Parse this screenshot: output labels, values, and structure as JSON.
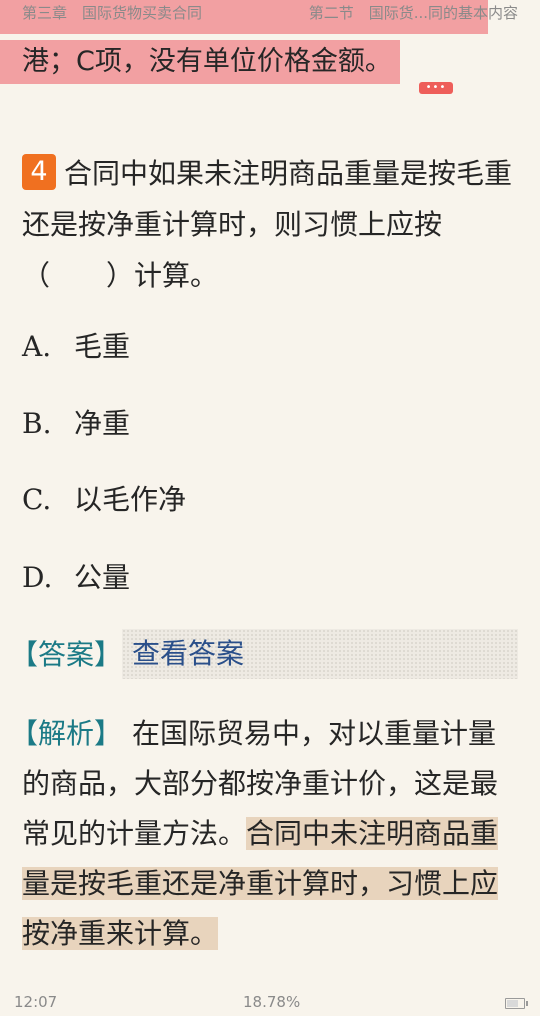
{
  "header": {
    "chapter": "第三章　国际货物买卖合同",
    "section": "第二节　国际货...同的基本内容"
  },
  "previous": {
    "text": "港；C项，没有单位价格金额。",
    "more_button": "•••"
  },
  "question": {
    "number": "4",
    "text": "合同中如果未注明商品重量是按毛重还是按净重计算时，则习惯上应按（　　）计算。",
    "options": [
      {
        "letter": "A.",
        "text": "毛重"
      },
      {
        "letter": "B.",
        "text": "净重"
      },
      {
        "letter": "C.",
        "text": "以毛作净"
      },
      {
        "letter": "D.",
        "text": "公量"
      }
    ]
  },
  "answer": {
    "label": "【答案】",
    "link": "查看答案"
  },
  "analysis": {
    "label": "【解析】",
    "text": "在国际贸易中，对以重量计量的商品，大部分都按净重计价，这是最常见的计量方法。",
    "highlight": "合同中未注明商品重量是按毛重还是净重计算时，习惯上应按净重来计算。"
  },
  "status": {
    "time": "12:07",
    "progress": "18.78%",
    "battery_level": 0.7
  },
  "colors": {
    "background": "#f8f4ec",
    "accent_teal": "#1b7a86",
    "link_blue": "#2a4f8a",
    "number_badge": "#f07020",
    "pink_highlight": "#f2a0a2",
    "tan_highlight": "#e8d4bd"
  }
}
